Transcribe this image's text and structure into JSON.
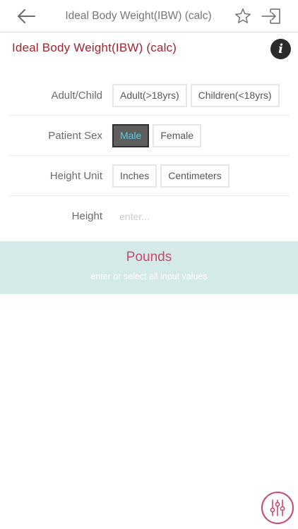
{
  "nav": {
    "title": "Ideal Body Weight(IBW) (calc)",
    "back_icon": "arrow-left-icon",
    "favorite_icon": "star-outline-icon",
    "exit_icon": "exit-to-icon"
  },
  "calculator": {
    "title": "Ideal Body Weight(IBW) (calc)",
    "info_label": "i"
  },
  "rows": {
    "adult_child": {
      "label": "Adult/Child",
      "options": [
        "Adult(>18yrs)",
        "Children(<18yrs)"
      ],
      "selected": null
    },
    "patient_sex": {
      "label": "Patient Sex",
      "options": [
        "Male",
        "Female"
      ],
      "selected": "Male"
    },
    "height_unit": {
      "label": "Height Unit",
      "options": [
        "Inches",
        "Centimeters"
      ],
      "selected": null
    },
    "height": {
      "label": "Height",
      "placeholder": "enter...",
      "value": ""
    }
  },
  "result": {
    "unit": "Pounds",
    "hint": "enter or select all input values"
  },
  "colors": {
    "title_red": "#a0232e",
    "accent_pink": "#c64a6c",
    "selected_bg": "#5e5e5e",
    "selected_text": "#4fd0e0",
    "result_bg": "#d4eae8"
  },
  "fab": {
    "icon": "sliders-icon"
  }
}
